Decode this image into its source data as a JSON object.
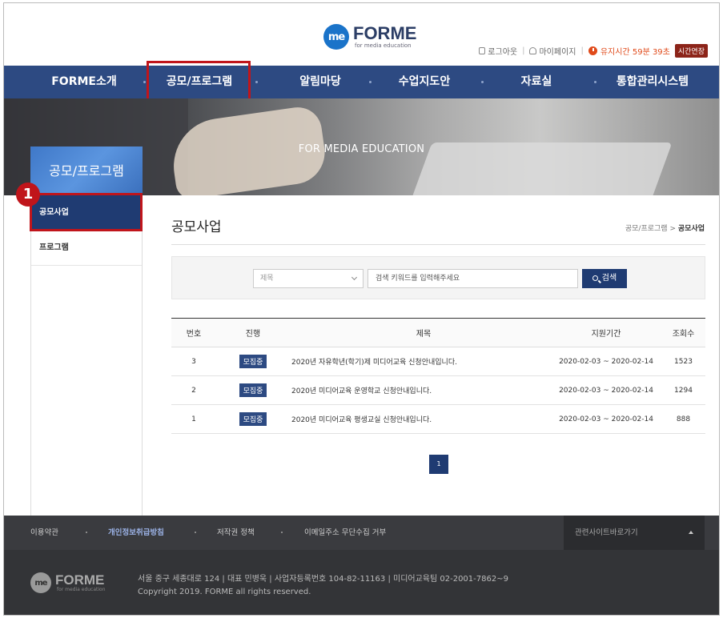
{
  "header": {
    "logo_mark": "me",
    "logo_name": "FORME",
    "logo_sub": "for media education",
    "logout": "로그아웃",
    "mypage": "마이페이지",
    "timer": "유지시간 59분 39초",
    "extend": "시간연장"
  },
  "nav": {
    "items": [
      "FORME소개",
      "공모/프로그램",
      "알림마당",
      "수업지도안",
      "자료실",
      "통합관리시스템"
    ]
  },
  "hero": {
    "title": "FOR MEDIA EDUCATION"
  },
  "lnb": {
    "title": "공모/프로그램",
    "items": [
      "공모사업",
      "프로그램"
    ],
    "step_badge": "1"
  },
  "content": {
    "page_title": "공모사업",
    "breadcrumb_parent": "공모/프로그램",
    "breadcrumb_current": "공모사업",
    "search": {
      "field_select": "제목",
      "placeholder": "검색 키워드를 입력해주세요",
      "button": "검색"
    },
    "table": {
      "headers": [
        "번호",
        "진행",
        "제목",
        "지원기간",
        "조회수"
      ],
      "rows": [
        {
          "no": "3",
          "status": "모집중",
          "title": "2020년 자유학년(학기)제 미디어교육 신청안내입니다.",
          "period": "2020-02-03 ~ 2020-02-14",
          "views": "1523"
        },
        {
          "no": "2",
          "status": "모집중",
          "title": "2020년 미디어교육 운영학교 신청안내입니다.",
          "period": "2020-02-03 ~ 2020-02-14",
          "views": "1294"
        },
        {
          "no": "1",
          "status": "모집중",
          "title": "2020년 미디어교육 평생교실 신청안내입니다.",
          "period": "2020-02-03 ~ 2020-02-14",
          "views": "888"
        }
      ]
    },
    "pager": "1"
  },
  "footer": {
    "links": [
      "이용약관",
      "개인정보취급방침",
      "저작권 정책",
      "이메일주소 무단수집 거부"
    ],
    "family_site": "관련사이트바로가기",
    "address": "서울 중구 세종대로 124  |  대표 민병욱  |  사업자등록번호 104-82-11163  |  미디어교육팀 02-2001-7862~9",
    "copyright": "Copyright 2019. FORME all rights reserved."
  }
}
